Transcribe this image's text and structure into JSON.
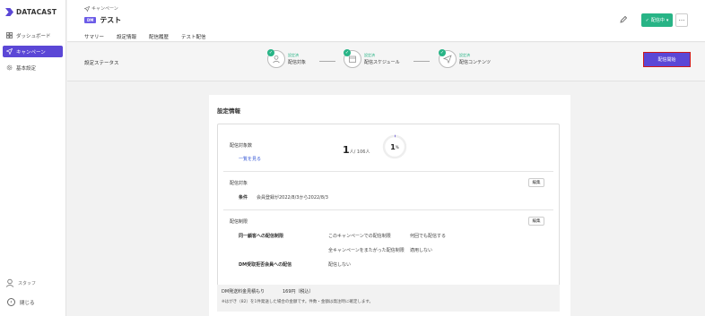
{
  "app": {
    "logo_text": "DATACAST",
    "accent": "#5b47d6",
    "success": "#28b486"
  },
  "sidebar": {
    "items": [
      {
        "label": "ダッシュボード",
        "icon": "grid-icon"
      },
      {
        "label": "キャンペーン",
        "icon": "send-icon",
        "active": true
      },
      {
        "label": "基本設定",
        "icon": "gear-icon"
      }
    ],
    "staff_label": "スタッフ",
    "close_label": "閉じる"
  },
  "header": {
    "breadcrumb": "キャンペーン",
    "badge": "DM",
    "title": "テスト",
    "status_button": "配信中",
    "more_label": "···",
    "tabs": [
      "サマリー",
      "設定情報",
      "配信履歴",
      "テスト配信"
    ],
    "active_tab": 1
  },
  "status_strip": {
    "label": "設定ステータス",
    "steps": [
      {
        "status": "設定済",
        "name": "配信対象",
        "icon": "person-icon"
      },
      {
        "status": "設定済",
        "name": "配信スケジュール",
        "icon": "calendar-icon"
      },
      {
        "status": "設定済",
        "name": "配信コンテンツ",
        "icon": "paper-plane-icon"
      }
    ],
    "start_button": "配信開始"
  },
  "settings": {
    "title": "設定情報",
    "target_count_label": "配信対象数",
    "list_link": "一覧を見る",
    "count_value": "1",
    "count_unit": "人/ 106人",
    "percent_value": "1",
    "percent_unit": "%",
    "target_section": {
      "title": "配信対象",
      "edit": "編集",
      "condition_label": "条件",
      "condition_value": "会員登録が2022/8/3から2022/8/3"
    },
    "restriction_section": {
      "title": "配信制限",
      "edit": "編集",
      "same_customer_label": "同一顧客への配信制限",
      "campaign_limit": "このキャンペーンでの配信制限",
      "campaign_limit_value": "何回でも配信する",
      "cross_campaign_limit": "全キャンペーンをまたがった配信制限",
      "cross_campaign_limit_value": "適用しない",
      "dm_reject_label": "DM受取拒否会員への配信",
      "dm_reject_value": "配信しない"
    },
    "fee": {
      "label": "DM発送料金見積もり",
      "value": "169円（税込）",
      "note": "※はがき（82）を1件発送した場合の金額です。件数・金額は発注時に確定します。"
    }
  }
}
